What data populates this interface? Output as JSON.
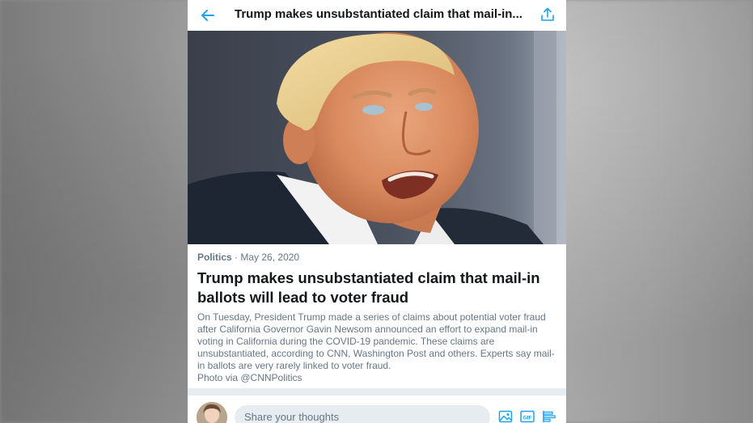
{
  "header": {
    "title": "Trump makes unsubstantiated claim that mail-in..."
  },
  "article": {
    "category": "Politics",
    "separator": "·",
    "date": "May 26, 2020",
    "headline": "Trump makes unsubstantiated claim that mail-in ballots will lead to voter fraud",
    "body": "On Tuesday, President Trump made a series of claims about potential voter fraud after California Governor Gavin Newsom announced an effort to expand mail-in voting in California during the COVID-19 pandemic. These claims are unsubstantiated, according to CNN, Washington Post and others. Experts say mail-in ballots are very rarely linked to voter fraud.",
    "credit": "Photo via @CNNPolitics"
  },
  "composer": {
    "placeholder": "Share your thoughts"
  },
  "icons": {
    "back": "back-arrow-icon",
    "share": "share-icon",
    "image": "image-icon",
    "gif": "gif-icon",
    "poll": "poll-icon"
  },
  "colors": {
    "accent": "#1da1f2",
    "text_primary": "#14171a",
    "text_secondary": "#657786",
    "divider": "#e6ecf0"
  }
}
